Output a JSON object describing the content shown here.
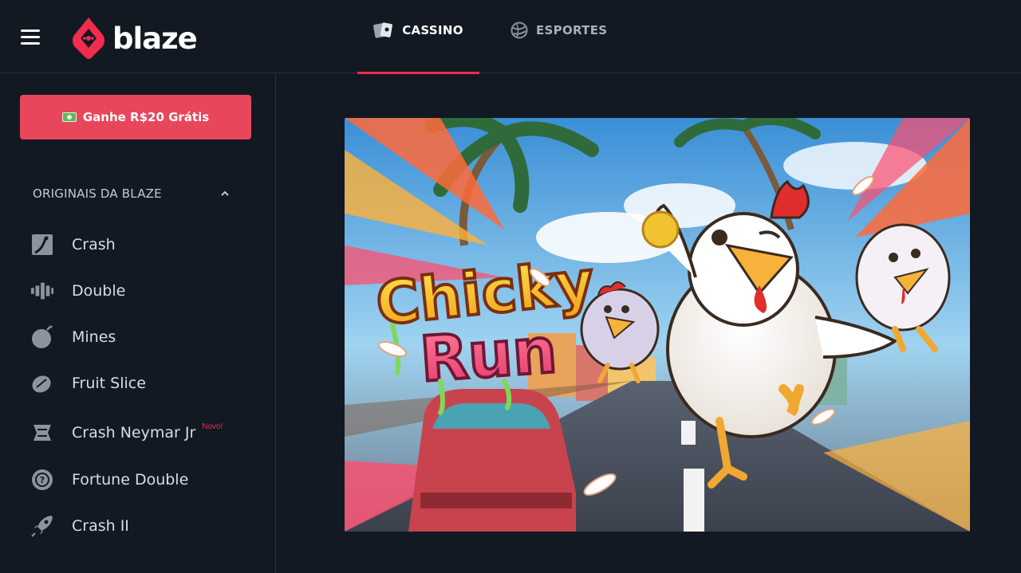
{
  "header": {
    "brand": "blaze",
    "tabs": [
      {
        "label": "CASSINO",
        "active": true,
        "icon": "cards-icon"
      },
      {
        "label": "ESPORTES",
        "active": false,
        "icon": "ball-icon"
      }
    ]
  },
  "sidebar": {
    "promo_button": "Ganhe R$20 Grátis",
    "section_title": "ORIGINAIS DA BLAZE",
    "items": [
      {
        "label": "Crash",
        "icon": "crash-icon"
      },
      {
        "label": "Double",
        "icon": "double-icon"
      },
      {
        "label": "Mines",
        "icon": "bomb-icon"
      },
      {
        "label": "Fruit Slice",
        "icon": "fruit-icon"
      },
      {
        "label": "Crash Neymar Jr",
        "icon": "neymar-icon",
        "badge": "Novo!"
      },
      {
        "label": "Fortune Double",
        "icon": "fortune-icon"
      },
      {
        "label": "Crash II",
        "icon": "rocket-icon"
      }
    ]
  },
  "banner": {
    "game_title_line1": "Chicky",
    "game_title_line2": "Run"
  },
  "colors": {
    "accent": "#f12c4c",
    "promo": "#e8465b",
    "background": "#131922"
  }
}
